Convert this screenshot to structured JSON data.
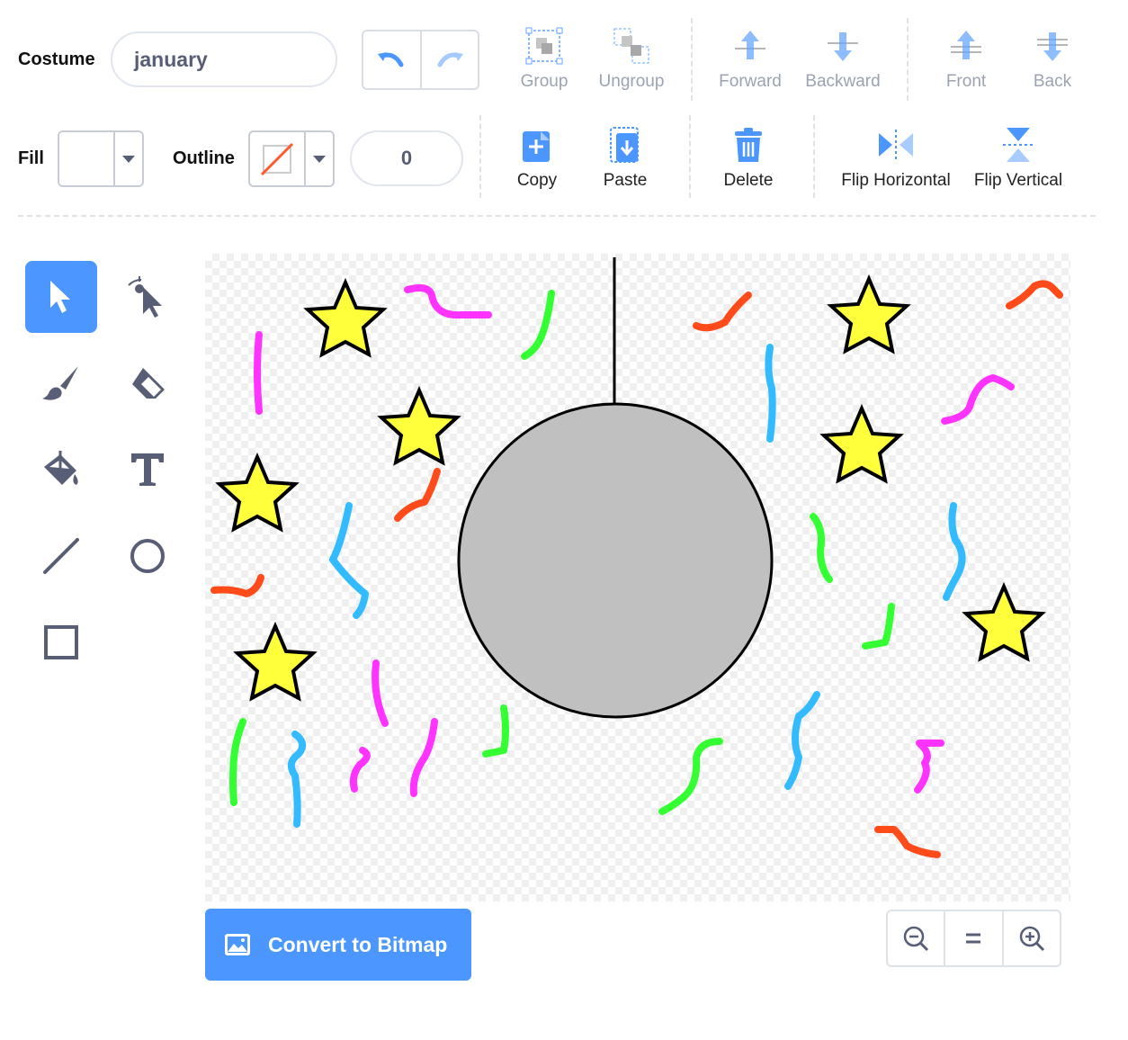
{
  "costume": {
    "label": "Costume",
    "name_value": "january"
  },
  "fill": {
    "label": "Fill",
    "color": "#ffffff"
  },
  "outline": {
    "label": "Outline",
    "width_value": "0"
  },
  "toolbar": {
    "group": "Group",
    "ungroup": "Ungroup",
    "forward": "Forward",
    "backward": "Backward",
    "front": "Front",
    "back": "Back",
    "copy": "Copy",
    "paste": "Paste",
    "delete": "Delete",
    "flip_horizontal": "Flip Horizontal",
    "flip_vertical": "Flip Vertical"
  },
  "tools": [
    "select-tool",
    "reshape-tool",
    "brush-tool",
    "eraser-tool",
    "fill-tool",
    "text-tool",
    "line-tool",
    "circle-tool",
    "rectangle-tool"
  ],
  "convert_button": "Convert to Bitmap",
  "colors": {
    "accent": "#4c97ff",
    "star": "#ffff3c",
    "ball": "#c0c0c0",
    "confetti": [
      "#ff33ff",
      "#33ff33",
      "#33bbff",
      "#ff4a1a"
    ]
  }
}
